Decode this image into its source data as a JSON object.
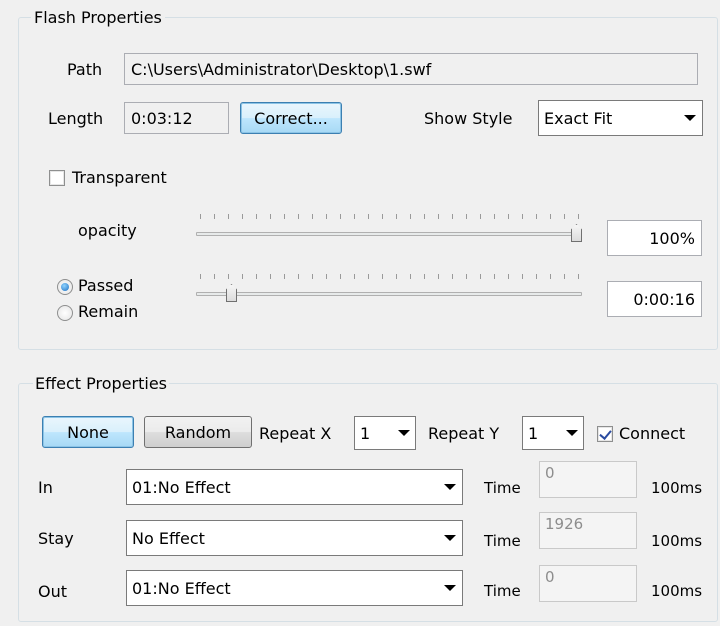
{
  "flash": {
    "title": "Flash Properties",
    "path_label": "Path",
    "path_value": "C:\\Users\\Administrator\\Desktop\\1.swf",
    "length_label": "Length",
    "length_value": "0:03:12",
    "correct_label": "Correct...",
    "show_style_label": "Show Style",
    "show_style_value": "Exact Fit",
    "transparent_label": "Transparent",
    "transparent_checked": false,
    "opacity_label": "opacity",
    "opacity_value": "100%",
    "opacity_fraction": 1.0,
    "passed_label": "Passed",
    "remain_label": "Remain",
    "position_selected": "Passed",
    "position_value": "0:00:16",
    "position_fraction": 0.08
  },
  "effect": {
    "title": "Effect Properties",
    "none_label": "None",
    "random_label": "Random",
    "repeat_x_label": "Repeat X",
    "repeat_x_value": "1",
    "repeat_y_label": "Repeat Y",
    "repeat_y_value": "1",
    "connect_label": "Connect",
    "connect_checked": true,
    "rows": [
      {
        "label": "In",
        "effect": "01:No Effect",
        "time_label": "Time",
        "time_value": "0",
        "unit": "100ms"
      },
      {
        "label": "Stay",
        "effect": "No Effect",
        "time_label": "Time",
        "time_value": "1926",
        "unit": "100ms"
      },
      {
        "label": "Out",
        "effect": "01:No Effect",
        "time_label": "Time",
        "time_value": "0",
        "unit": "100ms"
      }
    ]
  }
}
